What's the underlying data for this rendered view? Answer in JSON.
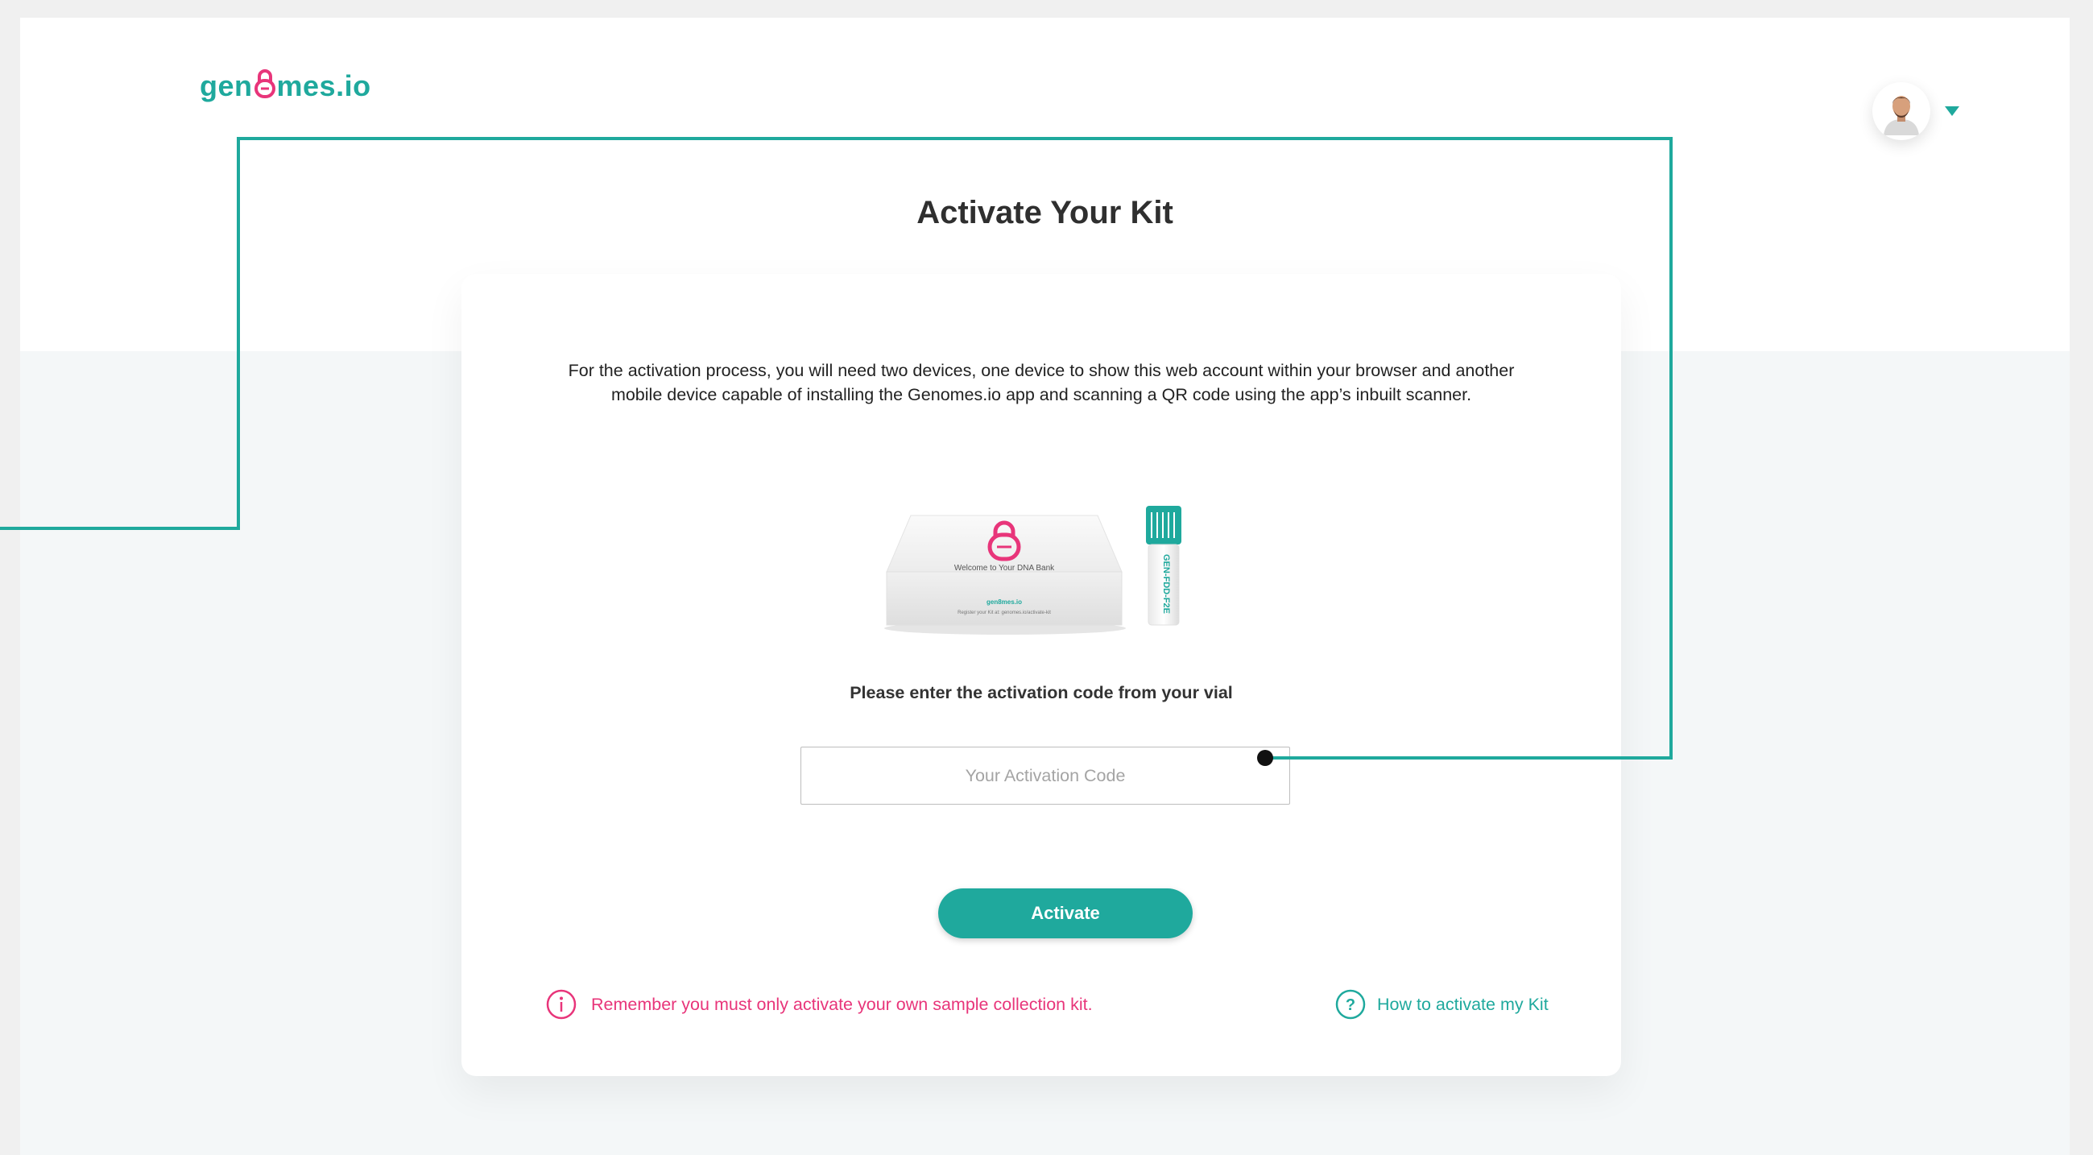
{
  "logo": {
    "left": "gen",
    "right": "mes.io"
  },
  "page": {
    "title": "Activate Your Kit"
  },
  "card": {
    "intro_line1": "For the activation process, you will need  two devices, one device to show this web account within your browser and another",
    "intro_line2": "mobile device capable of installing the Genomes.io app and scanning a QR code using the app’s inbuilt scanner.",
    "prompt": "Please enter the activation code from your vial",
    "input_placeholder": "Your Activation Code",
    "activate_label": "Activate",
    "warning_text": "Remember you must only activate your own sample collection kit.",
    "help_text": "How to activate my Kit"
  },
  "kit": {
    "box_text": "Welcome to Your DNA Bank",
    "box_brand": "gen8mes.io",
    "box_register": "Register your Kit at: genomes.io/activate-kit",
    "vial_label": "GEN-FDD-F2E"
  },
  "colors": {
    "brand_teal": "#1fa99d",
    "brand_pink": "#e8357a",
    "text_dark": "#2f2f2f"
  },
  "icons": {
    "user": "user-avatar",
    "menu": "chevron-down-icon",
    "warning": "info-circle-icon",
    "help": "question-circle-icon"
  }
}
